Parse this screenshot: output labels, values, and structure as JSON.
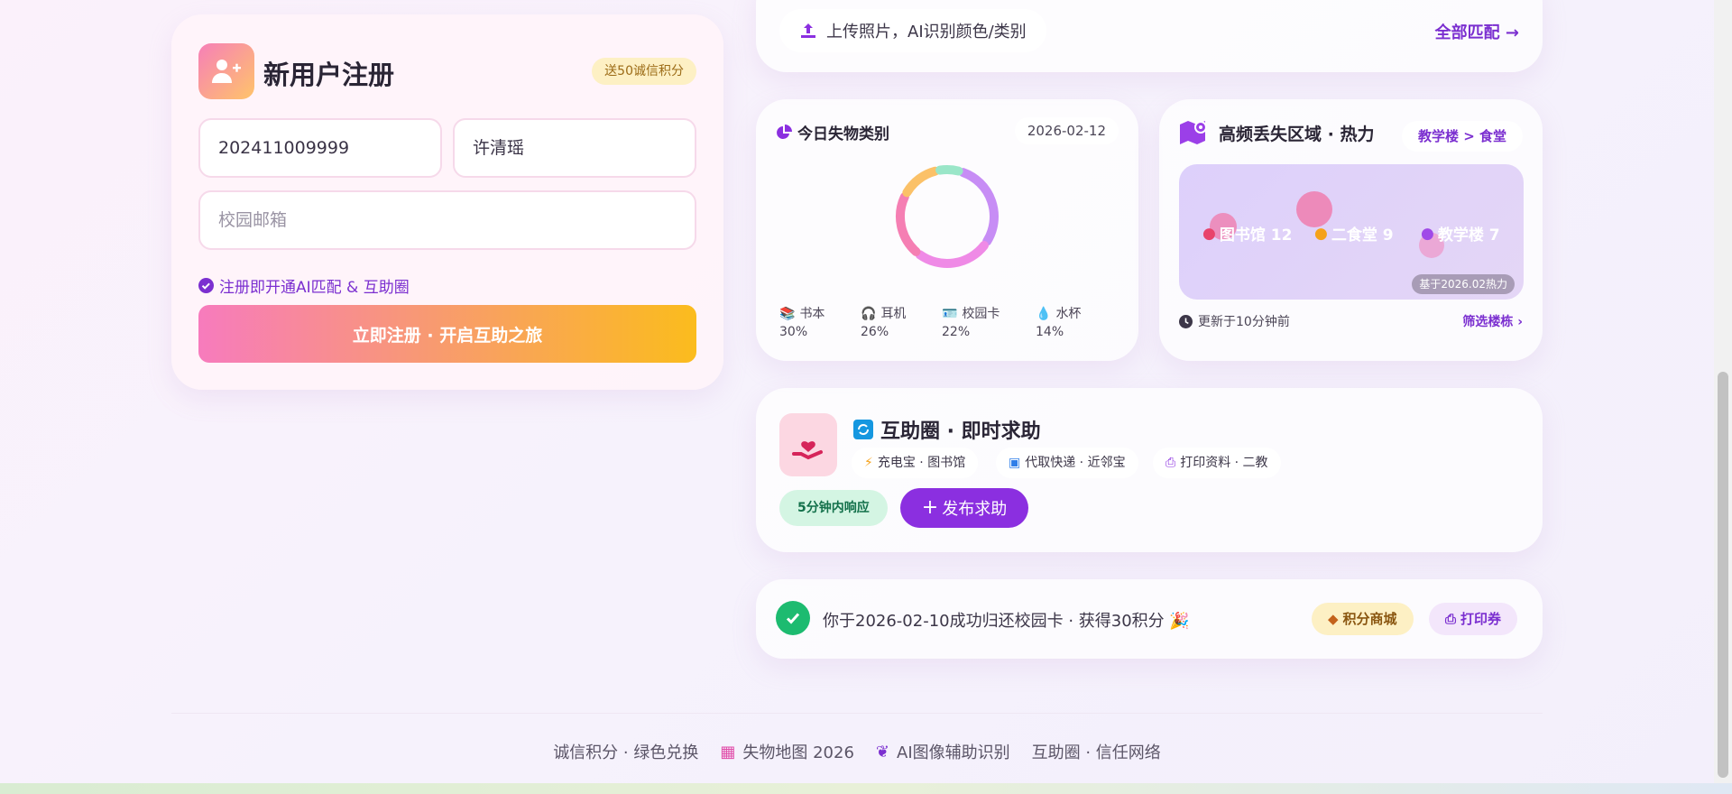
{
  "register": {
    "title": "新用户注册",
    "badge": "送50诚信积分",
    "student_id_value": "202411009999",
    "name_value": "许清瑶",
    "email_placeholder": "校园邮箱",
    "note": "注册即开通AI匹配 & 互助圈",
    "submit_label": "立即注册 · 开启互助之旅"
  },
  "upload": {
    "label": "上传照片，AI识别颜色/类别",
    "all_match_label": "全部匹配 →"
  },
  "categories": {
    "title": "今日失物类别",
    "date": "2026-02-12",
    "items": [
      {
        "name": "书本",
        "pct": "30%",
        "color": "#c78df5"
      },
      {
        "name": "耳机",
        "pct": "26%",
        "color": "#ef8ae6"
      },
      {
        "name": "校园卡",
        "pct": "22%",
        "color": "#f57fb3"
      },
      {
        "name": "水杯",
        "pct": "14%",
        "color": "#fbc168"
      }
    ],
    "extra_color": "#9ae6c8"
  },
  "heat": {
    "title": "高频丢失区域 · 热力",
    "route": "教学楼 > 食堂",
    "places": [
      {
        "label": "图书馆 12",
        "pin": "#e8436b"
      },
      {
        "label": "二食堂 9",
        "pin": "#f5a21b"
      },
      {
        "label": "教学楼 7",
        "pin": "#a04ae8"
      }
    ],
    "basis": "基于2026.02热力",
    "updated": "更新于10分钟前",
    "filter_label": "筛选楼栋 ›"
  },
  "help": {
    "title": "互助圈 · 即时求助",
    "tags": [
      "充电宝 · 图书馆",
      "代取快递 · 近邻宝",
      "打印资料 · 二教"
    ],
    "response": "5分钟内响应",
    "post_label": "发布求助"
  },
  "notice": {
    "text": "你于2026-02-10成功归还校园卡 · 获得30积分 🎉",
    "mall_label": "积分商城",
    "print_label": "打印券"
  },
  "footer": {
    "items": [
      "诚信积分 · 绿色兑换",
      "失物地图 2026",
      "AI图像辅助识别",
      "互助圈 · 信任网络"
    ]
  },
  "colors": {
    "accent": "#7b2fd0",
    "gradient_start": "#f77bbd",
    "gradient_end": "#fbbc1d",
    "success": "#1dbb70"
  }
}
